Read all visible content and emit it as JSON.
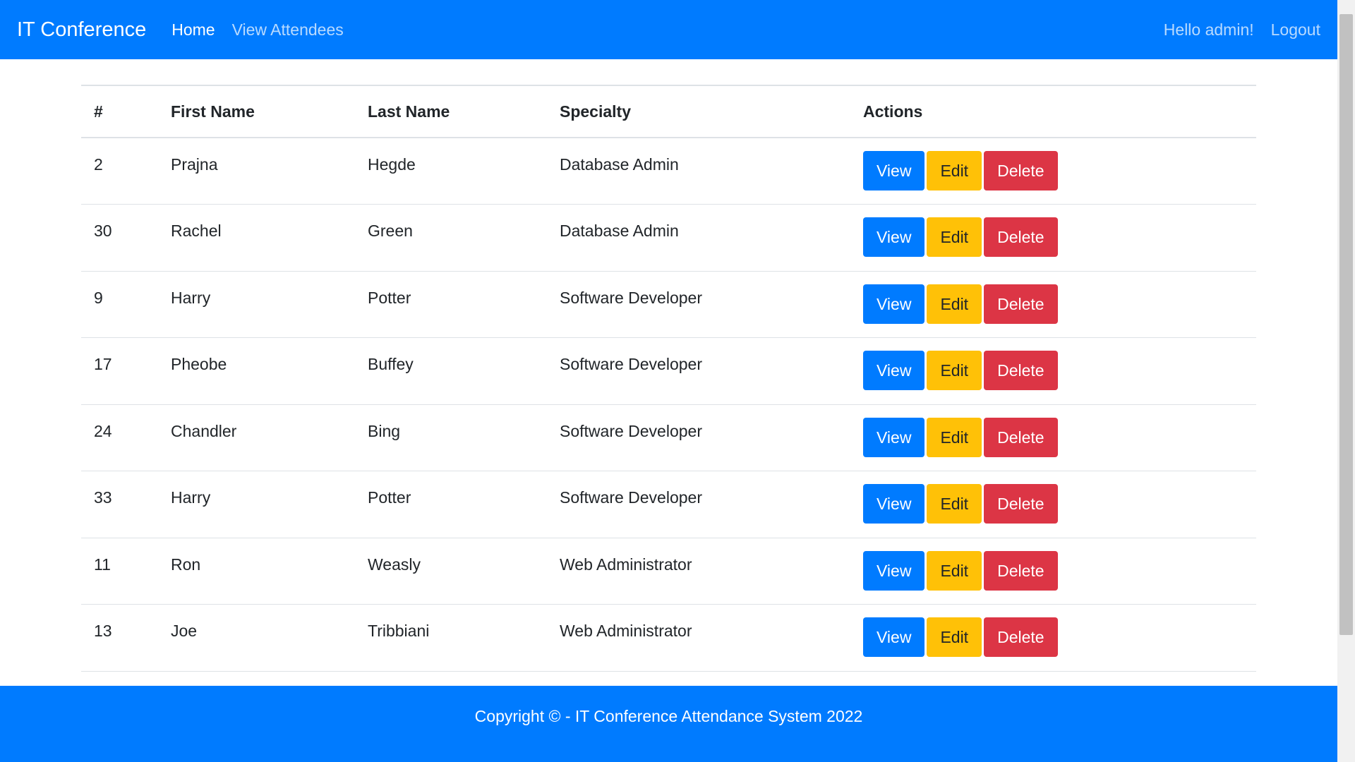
{
  "navbar": {
    "brand": "IT Conference",
    "links": [
      {
        "label": "Home",
        "active": true
      },
      {
        "label": "View Attendees",
        "active": false
      }
    ],
    "greeting": "Hello admin!",
    "logout_label": "Logout"
  },
  "table": {
    "headers": [
      "#",
      "First Name",
      "Last Name",
      "Specialty",
      "Actions"
    ],
    "rows": [
      {
        "id": "2",
        "first": "Prajna",
        "last": "Hegde",
        "specialty": "Database Admin"
      },
      {
        "id": "30",
        "first": "Rachel",
        "last": "Green",
        "specialty": "Database Admin"
      },
      {
        "id": "9",
        "first": "Harry",
        "last": "Potter",
        "specialty": "Software Developer"
      },
      {
        "id": "17",
        "first": "Pheobe",
        "last": "Buffey",
        "specialty": "Software Developer"
      },
      {
        "id": "24",
        "first": "Chandler",
        "last": "Bing",
        "specialty": "Software Developer"
      },
      {
        "id": "33",
        "first": "Harry",
        "last": "Potter",
        "specialty": "Software Developer"
      },
      {
        "id": "11",
        "first": "Ron",
        "last": "Weasly",
        "specialty": "Web Administrator"
      },
      {
        "id": "13",
        "first": "Joe",
        "last": "Tribbiani",
        "specialty": "Web Administrator"
      }
    ],
    "actions": {
      "view": "View",
      "edit": "Edit",
      "delete": "Delete"
    }
  },
  "footer": {
    "text": "Copyright © - IT Conference Attendance System 2022"
  },
  "colors": {
    "primary": "#007bff",
    "warning": "#ffc107",
    "danger": "#dc3545"
  }
}
